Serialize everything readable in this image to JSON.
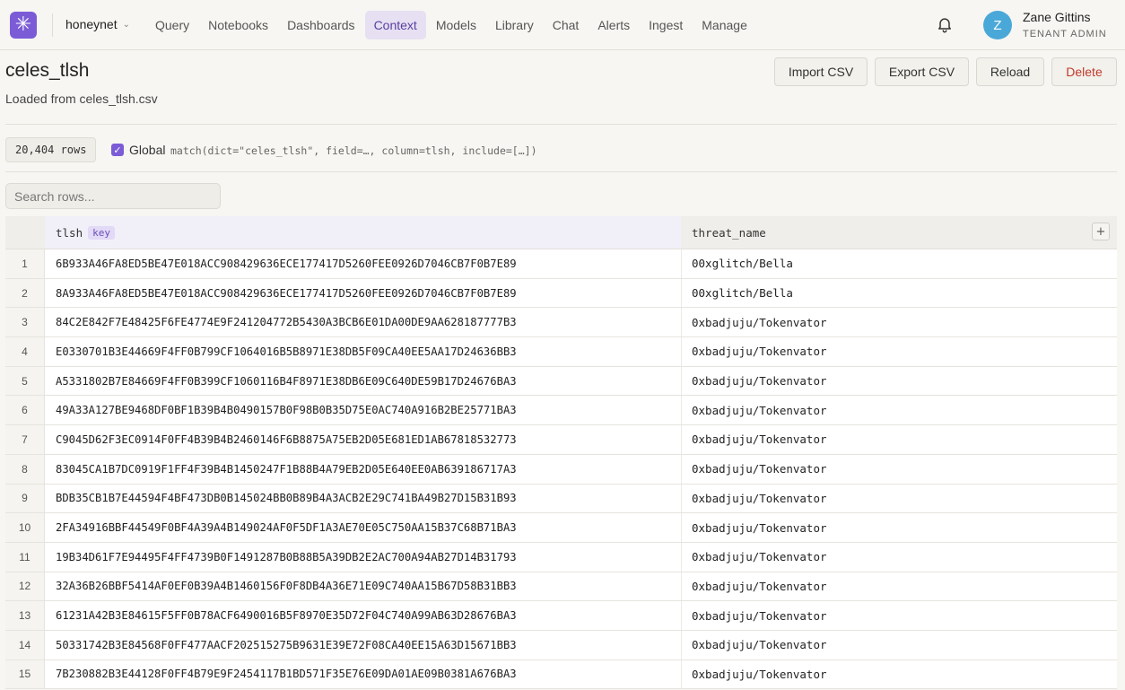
{
  "logo_glyph": "✳",
  "org": {
    "name": "honeynet"
  },
  "nav": [
    "Query",
    "Notebooks",
    "Dashboards",
    "Context",
    "Models",
    "Library",
    "Chat",
    "Alerts",
    "Ingest",
    "Manage"
  ],
  "nav_active": "Context",
  "user": {
    "initial": "Z",
    "name": "Zane Gittins",
    "role": "TENANT ADMIN"
  },
  "page": {
    "title": "celes_tlsh",
    "subtitle": "Loaded from celes_tlsh.csv"
  },
  "actions": {
    "import": "Import CSV",
    "export": "Export CSV",
    "reload": "Reload",
    "delete": "Delete"
  },
  "meta": {
    "rows": "20,404 rows",
    "global_label": "Global",
    "global_checked": true,
    "expression": "match(dict=\"celes_tlsh\", field=…, column=tlsh, include=[…])"
  },
  "search": {
    "placeholder": "Search rows..."
  },
  "table": {
    "columns": [
      {
        "name": "tlsh",
        "badge": "key"
      },
      {
        "name": "threat_name"
      }
    ],
    "add_column_glyph": "+",
    "rows": [
      {
        "n": "1",
        "tlsh": "6B933A46FA8ED5BE47E018ACC908429636ECE177417D5260FEE0926D7046CB7F0B7E89",
        "threat": "00xglitch/Bella"
      },
      {
        "n": "2",
        "tlsh": "8A933A46FA8ED5BE47E018ACC908429636ECE177417D5260FEE0926D7046CB7F0B7E89",
        "threat": "00xglitch/Bella"
      },
      {
        "n": "3",
        "tlsh": "84C2E842F7E48425F6FE4774E9F241204772B5430A3BCB6E01DA00DE9AA628187777B3",
        "threat": "0xbadjuju/Tokenvator"
      },
      {
        "n": "4",
        "tlsh": "E0330701B3E44669F4FF0B799CF1064016B5B8971E38DB5F09CA40EE5AA17D24636BB3",
        "threat": "0xbadjuju/Tokenvator"
      },
      {
        "n": "5",
        "tlsh": "A5331802B7E84669F4FF0B399CF1060116B4F8971E38DB6E09C640DE59B17D24676BA3",
        "threat": "0xbadjuju/Tokenvator"
      },
      {
        "n": "6",
        "tlsh": "49A33A127BE9468DF0BF1B39B4B0490157B0F98B0B35D75E0AC740A916B2BE25771BA3",
        "threat": "0xbadjuju/Tokenvator"
      },
      {
        "n": "7",
        "tlsh": "C9045D62F3EC0914F0FF4B39B4B2460146F6B8875A75EB2D05E681ED1AB67818532773",
        "threat": "0xbadjuju/Tokenvator"
      },
      {
        "n": "8",
        "tlsh": "83045CA1B7DC0919F1FF4F39B4B1450247F1B88B4A79EB2D05E640EE0AB639186717A3",
        "threat": "0xbadjuju/Tokenvator"
      },
      {
        "n": "9",
        "tlsh": "BDB35CB1B7E44594F4BF473DB0B145024BB0B89B4A3ACB2E29C741BA49B27D15B31B93",
        "threat": "0xbadjuju/Tokenvator"
      },
      {
        "n": "10",
        "tlsh": "2FA34916BBF44549F0BF4A39A4B149024AF0F5DF1A3AE70E05C750AA15B37C68B71BA3",
        "threat": "0xbadjuju/Tokenvator"
      },
      {
        "n": "11",
        "tlsh": "19B34D61F7E94495F4FF4739B0F1491287B0B88B5A39DB2E2AC700A94AB27D14B31793",
        "threat": "0xbadjuju/Tokenvator"
      },
      {
        "n": "12",
        "tlsh": "32A36B26BBF5414AF0EF0B39A4B1460156F0F8DB4A36E71E09C740AA15B67D58B31BB3",
        "threat": "0xbadjuju/Tokenvator"
      },
      {
        "n": "13",
        "tlsh": "61231A42B3E84615F5FF0B78ACF6490016B5F8970E35D72F04C740A99AB63D28676BA3",
        "threat": "0xbadjuju/Tokenvator"
      },
      {
        "n": "14",
        "tlsh": "50331742B3E84568F0FF477AACF202515275B9631E39E72F08CA40EE15A63D15671BB3",
        "threat": "0xbadjuju/Tokenvator"
      },
      {
        "n": "15",
        "tlsh": "7B230882B3E44128F0FF4B79E9F2454117B1BD571F35E76E09DA01AE09B0381A676BA3",
        "threat": "0xbadjuju/Tokenvator"
      }
    ]
  },
  "colors": {
    "accent": "#7b5cd6",
    "danger": "#c0392b",
    "avatar": "#4aa8d8",
    "nav_active_bg": "#e6e0f2"
  }
}
